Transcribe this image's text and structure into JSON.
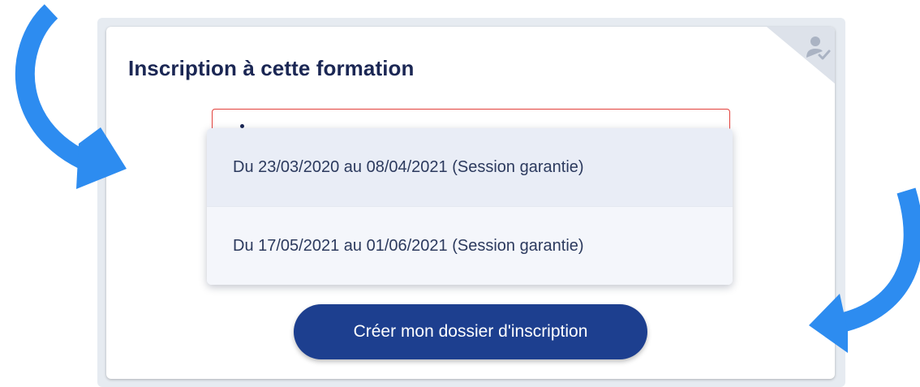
{
  "card": {
    "title": "Inscription à cette formation"
  },
  "session_select": {
    "state": "open, error-highlighted"
  },
  "dropdown": {
    "options": [
      {
        "label": "Du 23/03/2020 au 08/04/2021 (Session garantie)",
        "highlighted": true
      },
      {
        "label": "Du 17/05/2021 au 01/06/2021 (Session garantie)",
        "highlighted": false
      }
    ]
  },
  "actions": {
    "create_label": "Créer mon dossier d'inscription"
  },
  "icons": {
    "corner": "user-check-icon",
    "annotation_left": "curved-arrow-icon",
    "annotation_right": "curved-arrow-icon"
  },
  "colors": {
    "title": "#1b2754",
    "primary_button": "#1d3f8f",
    "error_border": "#e2403b",
    "annotation_arrow": "#2d8cf0",
    "option_highlight": "#e9edf6"
  }
}
